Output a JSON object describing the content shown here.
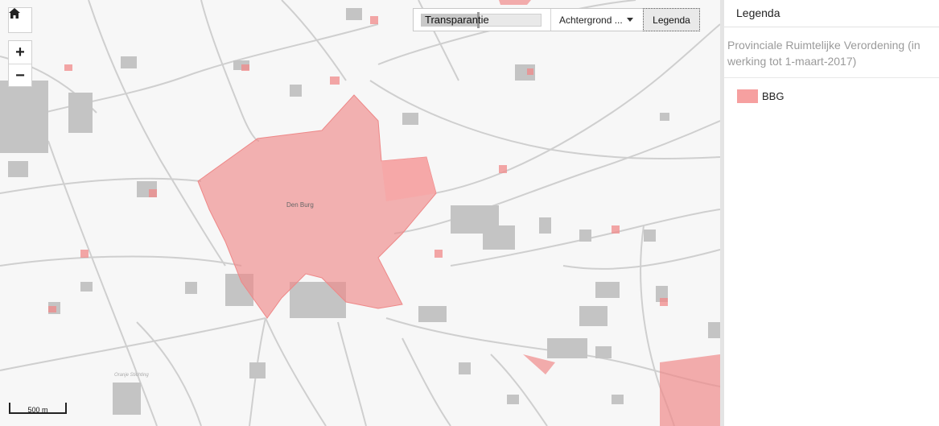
{
  "map": {
    "place_label": "Den Burg",
    "faint_label": "Oranje Stichting",
    "zoom_in_symbol": "+",
    "zoom_out_symbol": "−",
    "home_icon": "home-icon",
    "zone_color": "#f08a8a",
    "road_color": "#cfcfcf",
    "building_color": "#bdbdbd"
  },
  "toolbar": {
    "transparency_label": "Transparantie",
    "transparency_value": 0.47,
    "background_label": "Achtergrond ...",
    "legend_button_label": "Legenda"
  },
  "scale": {
    "label": "500 m"
  },
  "legend": {
    "title": "Legenda",
    "layer_title": "Provinciale Ruimtelijke Verordening (in werking tot 1-maart-2017)",
    "items": [
      {
        "label": "BBG",
        "color": "#f6a0a0"
      }
    ]
  }
}
